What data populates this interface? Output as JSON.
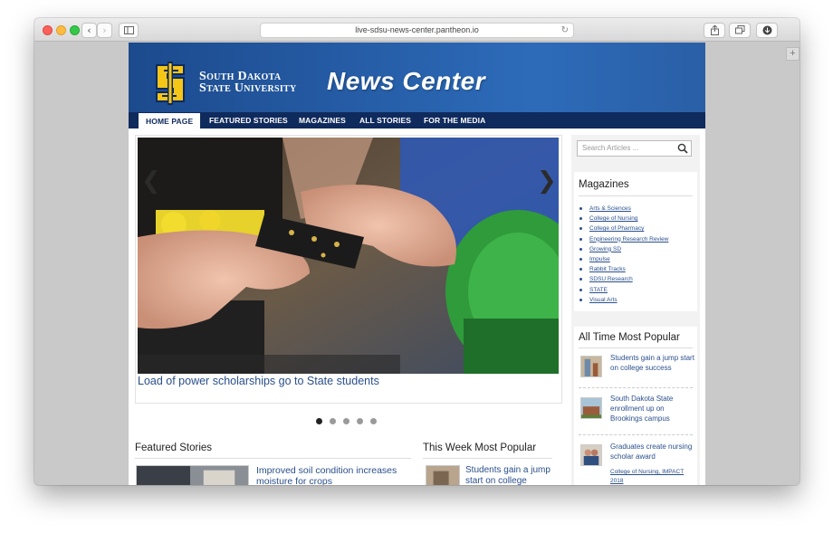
{
  "browser": {
    "url": "live-sdsu-news-center.pantheon.io",
    "back_glyph": "‹",
    "forward_glyph": "›",
    "reload_glyph": "↻",
    "new_tab_glyph": "+"
  },
  "site": {
    "university_line1": "South Dakota",
    "university_line2": "State University",
    "title": "News Center",
    "colors": {
      "brand_blue": "#1c4a8d",
      "nav_navy": "#0f2a5c",
      "link_blue": "#2a4f8c",
      "logo_yellow": "#f5c518"
    }
  },
  "nav": {
    "items": [
      {
        "label": "HOME PAGE"
      },
      {
        "label": "FEATURED STORIES"
      },
      {
        "label": "MAGAZINES"
      },
      {
        "label": "ALL STORIES"
      },
      {
        "label": "FOR THE MEDIA"
      }
    ]
  },
  "slideshow": {
    "caption": "Load of power scholarships go to State students",
    "prev_glyph": "❮",
    "next_glyph": "❯",
    "slide_count": 5,
    "active_slide": 1
  },
  "featured": {
    "title": "Featured Stories",
    "items": [
      {
        "title": "Improved soil condition increases moisture for crops"
      }
    ]
  },
  "week_popular": {
    "title": "This Week Most Popular",
    "items": [
      {
        "title": "Students gain a jump start on college success"
      }
    ]
  },
  "search": {
    "placeholder": "Search Articles ..."
  },
  "magazines": {
    "title": "Magazines",
    "items": [
      "Arts & Sciences",
      "College of Nursing",
      "College of Pharmacy",
      "Engineering Research Review",
      "Growing SD",
      "Impulse",
      "Rabbit Tracks",
      "SDSU Research",
      "STATE",
      "Visual Arts"
    ]
  },
  "all_time_popular": {
    "title": "All Time Most Popular",
    "items": [
      {
        "title": "Students gain a jump start on college success"
      },
      {
        "title": "South Dakota State enrollment up on Brookings campus"
      },
      {
        "title": "Graduates create nursing scholar award",
        "tags": "College of Nursing, IMPACT 2018"
      }
    ]
  }
}
